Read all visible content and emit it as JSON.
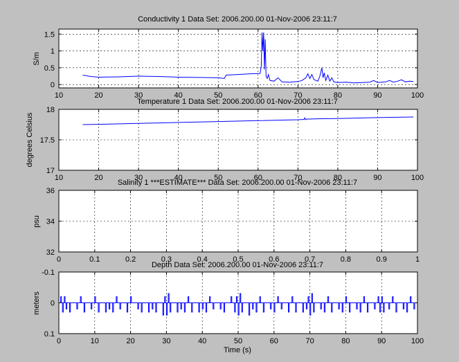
{
  "figure": {
    "background": "#c0c0c0",
    "axes_background": "#ffffff",
    "line_color": "#0000ff"
  },
  "chart_data": [
    {
      "type": "line",
      "title": "Conductivity 1  Data Set: 2006.200.00 01-Nov-2006 23:11:7",
      "xlabel": "",
      "ylabel": "S/m",
      "xlim": [
        10,
        100
      ],
      "ylim": [
        -0.1,
        1.65
      ],
      "xticks": [
        10,
        20,
        30,
        40,
        50,
        60,
        70,
        80,
        90,
        100
      ],
      "xticklabels": [
        "10",
        "20",
        "30",
        "40",
        "50",
        "60",
        "70",
        "80",
        "90",
        "100"
      ],
      "yticks": [
        0,
        0.5,
        1,
        1.5
      ],
      "yticklabels": [
        "0",
        "0.5",
        "1",
        "1.5"
      ],
      "y_reversed": false,
      "grid": true,
      "series": [
        {
          "color": "#0000ff",
          "x": [
            16,
            18,
            20,
            25,
            30,
            35,
            40,
            45,
            50,
            51.5,
            52,
            55,
            58,
            60.5,
            60.8,
            61,
            61.2,
            61.4,
            61.6,
            61.8,
            62,
            62.3,
            62.6,
            63,
            64,
            65,
            66,
            68,
            70,
            71,
            72,
            72.5,
            73,
            73.5,
            74,
            75,
            75.5,
            76,
            76.3,
            76.6,
            77,
            77.5,
            78,
            78.5,
            79,
            80,
            82,
            84,
            86,
            88,
            89,
            90,
            92,
            93,
            94,
            95,
            96,
            97,
            98,
            99
          ],
          "y": [
            0.28,
            0.24,
            0.22,
            0.23,
            0.25,
            0.24,
            0.22,
            0.21,
            0.2,
            0.18,
            0.28,
            0.3,
            0.32,
            0.33,
            0.55,
            1.55,
            1.0,
            1.55,
            0.45,
            1.35,
            0.25,
            0.18,
            0.3,
            0.12,
            0.1,
            0.2,
            0.08,
            0.07,
            0.09,
            0.12,
            0.2,
            0.32,
            0.18,
            0.3,
            0.15,
            0.1,
            0.25,
            0.5,
            0.2,
            0.35,
            0.12,
            0.28,
            0.1,
            0.2,
            0.08,
            0.06,
            0.07,
            0.05,
            0.06,
            0.07,
            0.12,
            0.06,
            0.08,
            0.12,
            0.07,
            0.1,
            0.14,
            0.08,
            0.1,
            0.09
          ]
        }
      ]
    },
    {
      "type": "line",
      "title": "Temperature 1  Data Set: 2006.200.00 01-Nov-2006 23:11:7",
      "xlabel": "",
      "ylabel": "degrees Celsius",
      "xlim": [
        10,
        100
      ],
      "ylim": [
        17,
        18
      ],
      "xticks": [
        10,
        20,
        30,
        40,
        50,
        60,
        70,
        80,
        90,
        100
      ],
      "xticklabels": [
        "10",
        "20",
        "30",
        "40",
        "50",
        "60",
        "70",
        "80",
        "90",
        "100"
      ],
      "yticks": [
        17,
        17.5,
        18
      ],
      "yticklabels": [
        "17",
        "17.5",
        "18"
      ],
      "y_reversed": false,
      "grid": true,
      "series": [
        {
          "color": "#0000ff",
          "x": [
            16,
            20,
            30,
            40,
            50,
            60,
            70,
            71.5,
            71.7,
            71.9,
            72.1,
            75,
            80,
            90,
            99
          ],
          "y": [
            17.75,
            17.755,
            17.77,
            17.785,
            17.8,
            17.815,
            17.83,
            17.835,
            17.86,
            17.83,
            17.84,
            17.845,
            17.85,
            17.865,
            17.875
          ]
        }
      ]
    },
    {
      "type": "line",
      "title": "Salinity 1 ***ESTIMATE***  Data Set: 2006.200.00 01-Nov-2006 23:11:7",
      "xlabel": "",
      "ylabel": "psu",
      "xlim": [
        0,
        1
      ],
      "ylim": [
        32,
        36
      ],
      "xticks": [
        0,
        0.1,
        0.2,
        0.3,
        0.4,
        0.5,
        0.6,
        0.7,
        0.8,
        0.9,
        1
      ],
      "xticklabels": [
        "0",
        "0.1",
        "0.2",
        "0.3",
        "0.4",
        "0.5",
        "0.6",
        "0.7",
        "0.8",
        "0.9",
        "1"
      ],
      "yticks": [
        32,
        34,
        36
      ],
      "yticklabels": [
        "32",
        "34",
        "36"
      ],
      "y_reversed": false,
      "grid": true,
      "series": []
    },
    {
      "type": "line",
      "title": "Depth  Data Set: 2006.200.00 01-Nov-2006 23:11:7",
      "xlabel": "Time (s)",
      "ylabel": "meters",
      "xlim": [
        0,
        100
      ],
      "ylim": [
        -0.1,
        0.1
      ],
      "xticks": [
        0,
        10,
        20,
        30,
        40,
        50,
        60,
        70,
        80,
        90,
        100
      ],
      "xticklabels": [
        "0",
        "10",
        "20",
        "30",
        "40",
        "50",
        "60",
        "70",
        "80",
        "90",
        "100"
      ],
      "yticks": [
        -0.1,
        0,
        0.1
      ],
      "yticklabels": [
        "-0.1",
        "0",
        "0.1"
      ],
      "y_reversed": true,
      "grid": true,
      "series": [
        {
          "color": "#0000ff",
          "x": [
            0.5,
            1,
            1.5,
            2,
            3,
            4,
            5,
            6,
            7,
            8,
            9,
            10,
            11,
            12,
            13,
            14,
            15,
            16,
            17,
            18,
            19,
            20,
            21,
            22,
            23,
            24,
            25,
            26,
            27,
            28,
            29,
            29.5,
            30,
            30.5,
            31,
            32,
            33,
            34,
            35,
            36,
            37,
            38,
            39,
            40,
            41,
            42,
            43,
            44,
            45,
            46,
            47,
            48,
            49,
            49.5,
            50,
            50.5,
            51,
            52,
            53,
            54,
            55,
            56,
            57,
            58,
            59,
            60,
            61,
            62,
            63,
            64,
            65,
            66,
            67,
            68,
            69,
            69.5,
            70,
            70.5,
            71,
            72,
            73,
            74,
            75,
            76,
            77,
            78,
            79,
            80,
            81,
            82,
            83,
            84,
            85,
            86,
            87,
            88,
            89,
            89.5,
            90,
            90.5,
            91,
            92,
            93,
            94,
            95,
            96,
            97,
            98,
            99
          ],
          "y": [
            -0.02,
            0.03,
            -0.02,
            0.02,
            0.03,
            0,
            0.02,
            -0.02,
            0.03,
            0,
            0.02,
            -0.02,
            0.03,
            0,
            0.03,
            0.02,
            0.03,
            -0.02,
            0.02,
            0,
            0.03,
            -0.02,
            0,
            0.02,
            0.03,
            0,
            0.03,
            0.02,
            0.03,
            0,
            0.04,
            -0.02,
            0.04,
            -0.03,
            0.03,
            0,
            0.03,
            0.02,
            0.03,
            -0.02,
            0.03,
            0,
            0.03,
            0.02,
            0.03,
            -0.02,
            0.02,
            0,
            0.02,
            0.03,
            0,
            -0.02,
            0.03,
            -0.02,
            0.04,
            -0.03,
            0.03,
            0,
            0.04,
            0.02,
            0.03,
            -0.02,
            0.03,
            0,
            0.02,
            0.03,
            -0.02,
            0.02,
            0,
            0.03,
            -0.02,
            0.03,
            0,
            0.03,
            0.02,
            -0.02,
            0.04,
            -0.03,
            0.03,
            0,
            0.02,
            0.03,
            -0.02,
            0.03,
            0,
            0.02,
            0.03,
            -0.02,
            0.03,
            0,
            0.02,
            0.03,
            -0.02,
            0.03,
            0,
            0.02,
            -0.02,
            0.03,
            -0.02,
            0.03,
            0,
            0.02,
            -0.02,
            0.03,
            0,
            0.02,
            0.03,
            -0.02,
            0.02
          ]
        }
      ]
    }
  ]
}
